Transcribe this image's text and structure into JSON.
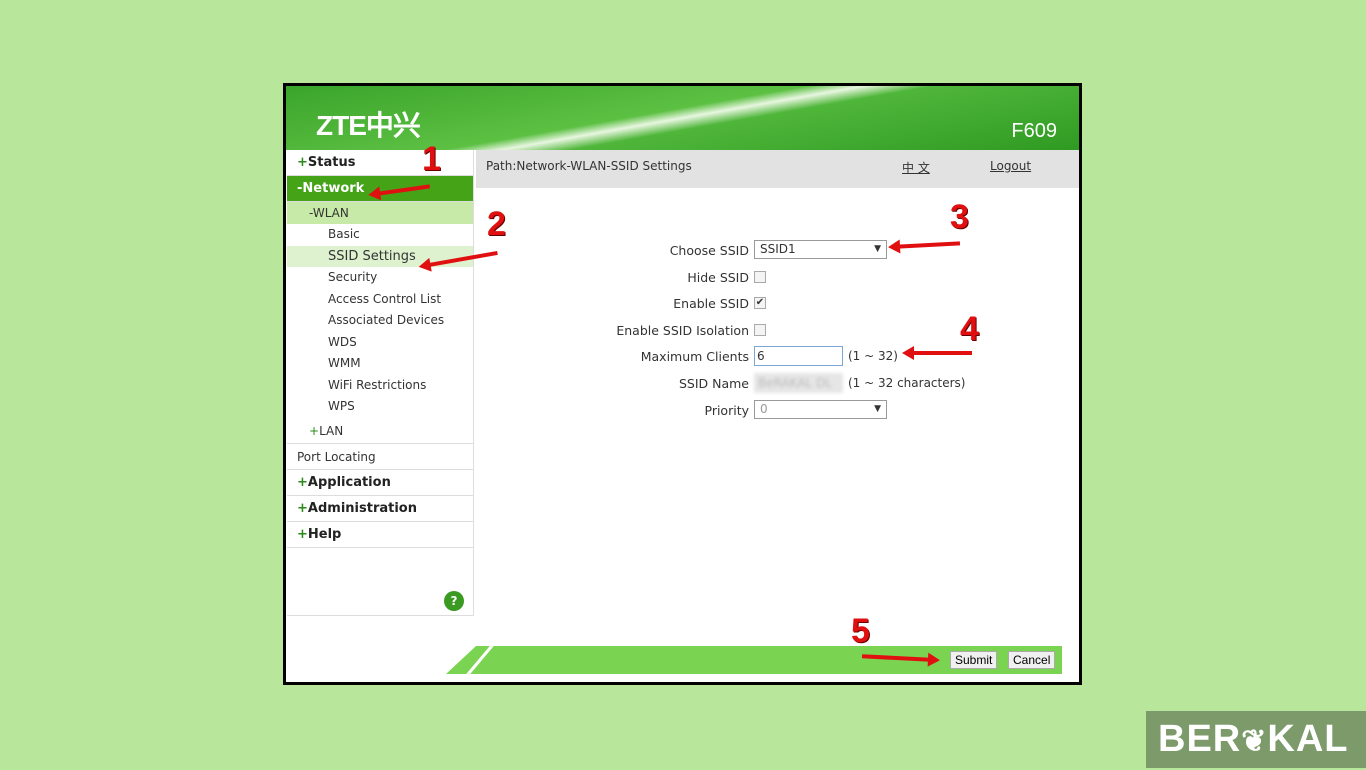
{
  "header": {
    "logo": "ZTE中兴",
    "model": "F609"
  },
  "sidebar": {
    "status": "Status",
    "network": "Network",
    "wlan": "WLAN",
    "wlan_items": [
      "Basic",
      "SSID Settings",
      "Security",
      "Access Control List",
      "Associated Devices",
      "WDS",
      "WMM",
      "WiFi Restrictions",
      "WPS"
    ],
    "lan": "LAN",
    "port_locating": "Port Locating",
    "application": "Application",
    "administration": "Administration",
    "help": "Help",
    "plus": "+",
    "minus": "-",
    "help_icon": "?"
  },
  "topbar": {
    "path": "Path:Network-WLAN-SSID Settings",
    "language": "中 文",
    "logout": "Logout"
  },
  "form": {
    "choose_ssid": {
      "label": "Choose SSID",
      "value": "SSID1"
    },
    "hide_ssid": {
      "label": "Hide SSID",
      "checked": false
    },
    "enable_ssid": {
      "label": "Enable SSID",
      "checked": true,
      "mark": "✔"
    },
    "isolation": {
      "label": "Enable SSID Isolation",
      "checked": false
    },
    "max_clients": {
      "label": "Maximum Clients",
      "value": "6",
      "hint": "(1 ~ 32)"
    },
    "ssid_name": {
      "label": "SSID Name",
      "value": "BeRAKAL DL",
      "hint": "(1 ~ 32 characters)"
    },
    "priority": {
      "label": "Priority",
      "value": "0"
    }
  },
  "footer": {
    "submit": "Submit",
    "cancel": "Cancel"
  },
  "annotations": [
    "1",
    "2",
    "3",
    "4",
    "5"
  ],
  "watermark": {
    "left": "BER",
    "right": "KAL",
    "full": "BERAKAL"
  },
  "colors": {
    "brand_green": "#45a318",
    "background": "#b8e69a",
    "annotation_red": "#e01010"
  }
}
